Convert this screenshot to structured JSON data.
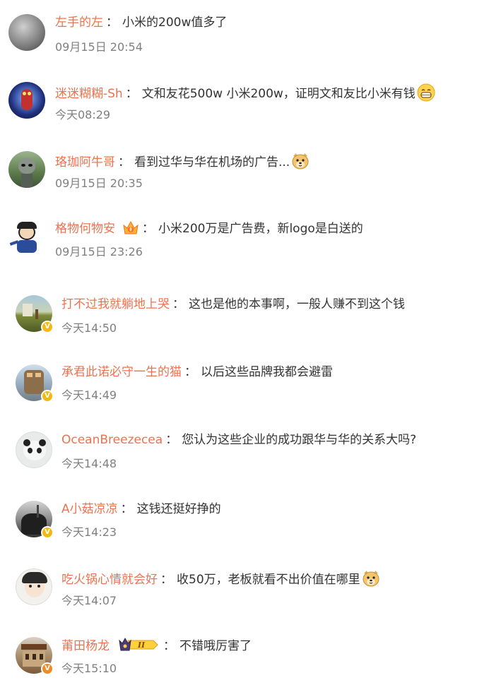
{
  "colors": {
    "username": "#eb7350",
    "text": "#333333",
    "time": "#808080",
    "verified": "#f3b813"
  },
  "comments": [
    {
      "user": "左手的左",
      "separator": "：",
      "text": "小米的200w值多了",
      "time": "09月15日 20:54",
      "verified": false,
      "emoji": null,
      "avatar": "gray-gradient-avatar"
    },
    {
      "user": "迷迷糊糊-Sh",
      "separator": "：",
      "text": "文和友花500w 小米200w，证明文和友比小米有钱",
      "time": "今天08:29",
      "verified": false,
      "emoji": "grin-emoji",
      "avatar": "ultraman-avatar"
    },
    {
      "user": "珞珈阿牛哥",
      "separator": "：",
      "text": "看到过华与华在机场的广告...",
      "time": "09月15日 20:35",
      "verified": false,
      "emoji": "doge-emoji",
      "avatar": "alien-avatar"
    },
    {
      "user": "格物何物安",
      "separator": "：",
      "text": "小米200万是广告费，新logo是白送的",
      "time": "09月15日 23:26",
      "verified": false,
      "emoji": null,
      "member_badge": "member-flame-badge",
      "avatar": "cartoon-boy-avatar"
    },
    {
      "user": "打不过我就躺地上哭",
      "separator": "：",
      "text": "这也是他的本事啊，一般人赚不到这个钱",
      "time": "今天14:50",
      "verified": true,
      "emoji": null,
      "avatar": "field-avatar"
    },
    {
      "user": "承君此诺必守一生的猫",
      "separator": "：",
      "text": "以后这些品牌我都会避雷",
      "time": "今天14:49",
      "verified": true,
      "emoji": null,
      "avatar": "robot-avatar"
    },
    {
      "user": "OceanBreezecea",
      "separator": "：",
      "text": "您认为这些企业的成功跟华与华的关系大吗?",
      "time": "今天14:48",
      "verified": false,
      "emoji": null,
      "avatar": "panda-avatar"
    },
    {
      "user": "A小菇凉凉",
      "separator": "：",
      "text": "这钱还挺好挣的",
      "time": "今天14:23",
      "verified": true,
      "emoji": null,
      "avatar": "dark-scene-avatar"
    },
    {
      "user": "吃火锅心情就会好",
      "separator": "：",
      "text": "收50万，老板就看不出价值在哪里",
      "time": "今天14:07",
      "verified": false,
      "emoji": "doge-emoji",
      "avatar": "girl-avatar"
    },
    {
      "user": "莆田杨龙",
      "separator": "：",
      "text": "不错哦厉害了",
      "time": "今天15:10",
      "verified": true,
      "verified_color": "orange",
      "emoji": null,
      "rank_badge": "II",
      "avatar": "building-avatar"
    }
  ]
}
